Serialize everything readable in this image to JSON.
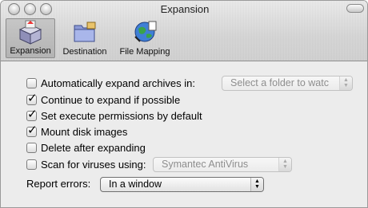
{
  "window": {
    "title": "Expansion"
  },
  "toolbar": {
    "items": [
      {
        "label": "Expansion",
        "icon": "package-icon",
        "selected": true
      },
      {
        "label": "Destination",
        "icon": "folder-icon",
        "selected": false
      },
      {
        "label": "File Mapping",
        "icon": "globe-icon",
        "selected": false
      }
    ]
  },
  "options": {
    "auto_expand": {
      "label": "Automatically expand archives in:",
      "checked": false
    },
    "auto_expand_folder": {
      "value": "Select a folder to watc"
    },
    "continue_expand": {
      "label": "Continue to expand if possible",
      "checked": true
    },
    "exec_perms": {
      "label": "Set execute permissions by default",
      "checked": true
    },
    "mount_images": {
      "label": "Mount disk images",
      "checked": true
    },
    "delete_after": {
      "label": "Delete after expanding",
      "checked": false
    },
    "scan_viruses": {
      "label": "Scan for viruses using:",
      "checked": false
    },
    "scanner": {
      "value": "Symantec AntiVirus"
    },
    "report_errors": {
      "label": "Report errors:",
      "value": "In a window"
    }
  },
  "glyphs": {
    "check": "✓",
    "popup_arrows_up": "▲",
    "popup_arrows_down": "▼"
  }
}
